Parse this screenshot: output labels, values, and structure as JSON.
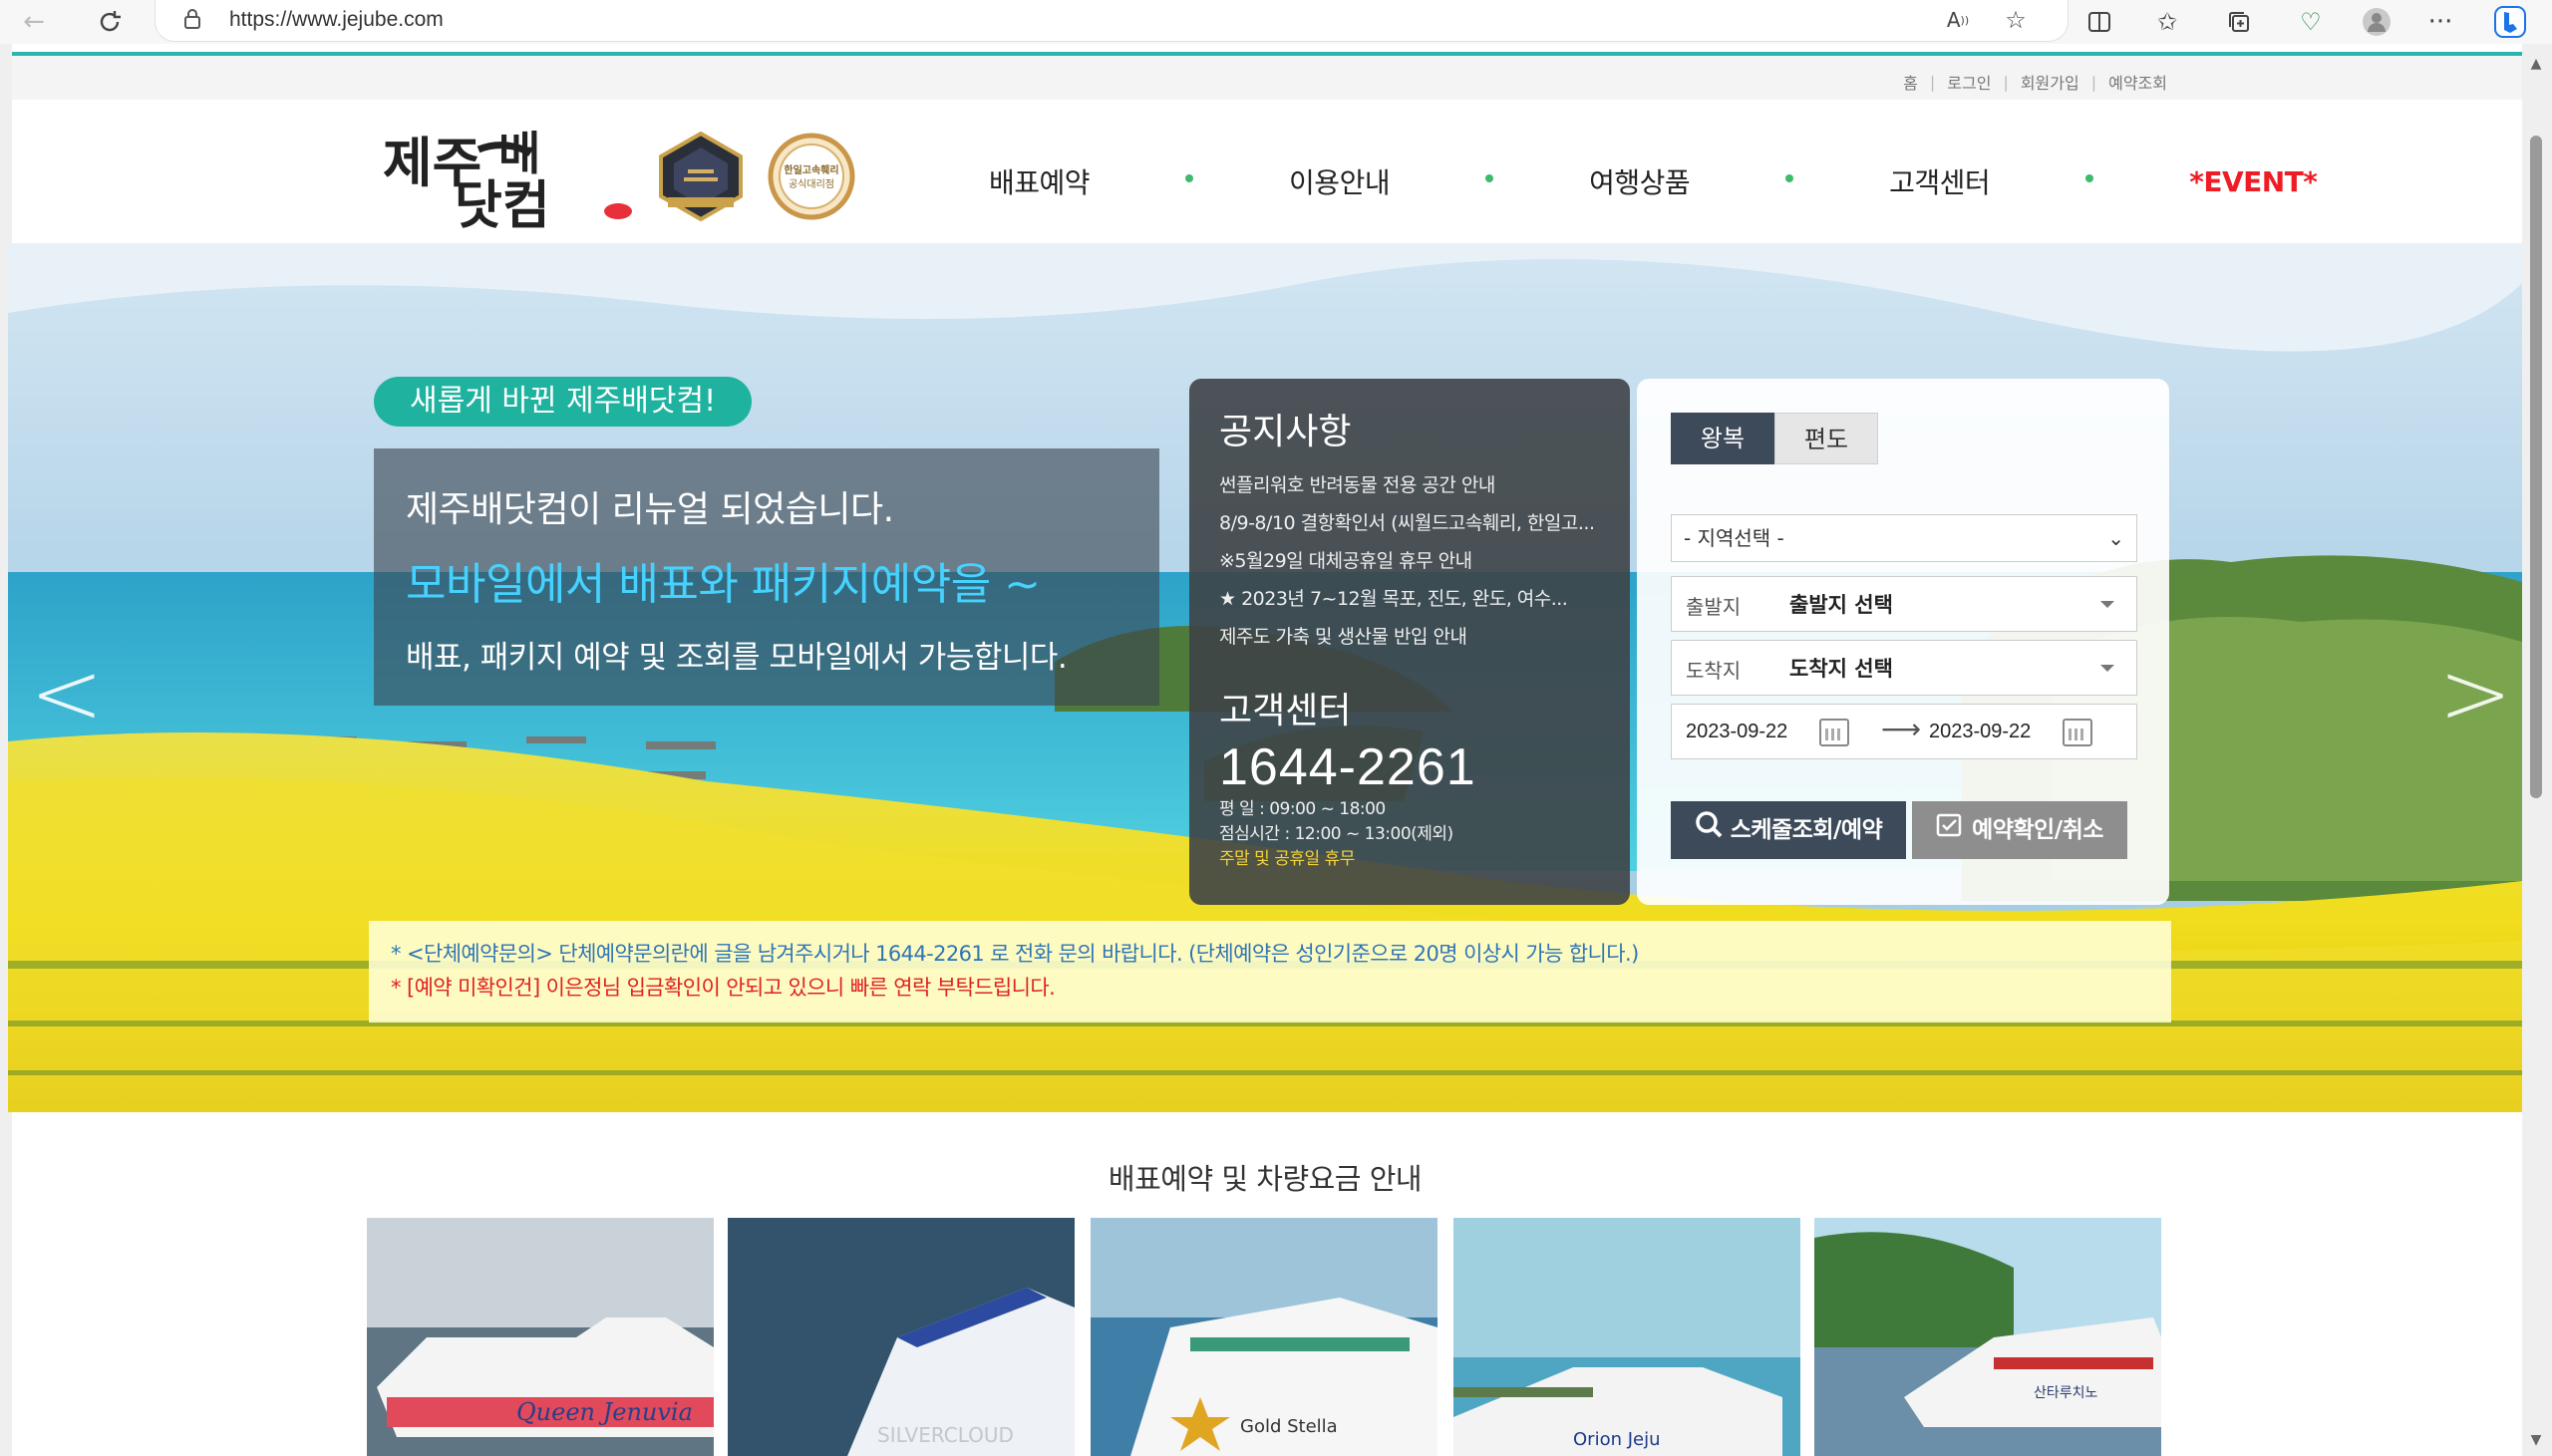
{
  "browser": {
    "url": "https://www.jejube.com",
    "back_icon": "back-arrow-icon",
    "reload_icon": "reload-icon"
  },
  "util_links": [
    {
      "label": "홈"
    },
    {
      "label": "로그인"
    },
    {
      "label": "회원가입"
    },
    {
      "label": "예약조회"
    }
  ],
  "header": {
    "logo_text": "제주배닷컴",
    "badge_right_text": "한일고속훼리 공식대리점",
    "nav": [
      "배표예약",
      "이용안내",
      "여행상품",
      "고객센터",
      "*EVENT*"
    ]
  },
  "hero": {
    "pill": "새롭게 바뀐 제주배닷컴!",
    "line1": "제주배닷컴이 리뉴얼 되었습니다.",
    "line2": "모바일에서 배표와 패키지예약을 ~",
    "line3": "배표, 패키지 예약 및 조회를 모바일에서 가능합니다."
  },
  "notice": {
    "title": "공지사항",
    "items": [
      "썬플리워호 반려동물 전용 공간 안내",
      "8/9-8/10 결항확인서 (씨월드고속훼리, 한일고...",
      "※5월29일 대체공휴일 휴무 안내",
      "★ 2023년 7~12월 목포, 진도, 완도, 여수...",
      "제주도 가축 및 생산물 반입 안내"
    ],
    "cs_title": "고객센터",
    "cs_phone": "1644-2261",
    "cs_weekday": "평 일 : 09:00 ~ 18:00",
    "cs_lunch": "점심시간 : 12:00 ~ 13:00(제외)",
    "cs_holiday": "주말 및 공휴일 휴무"
  },
  "booking": {
    "tab_round": "왕복",
    "tab_oneway": "편도",
    "region_select": "- 지역선택 -",
    "depart_label": "출발지",
    "depart_value": "출발지 선택",
    "arrive_label": "도착지",
    "arrive_value": "도착지 선택",
    "date_from": "2023-09-22",
    "date_to": "2023-09-22",
    "search_button": "스케줄조회/예약",
    "confirm_button": "예약확인/취소"
  },
  "alerts": {
    "line1": "* <단체예약문의> 단체예약문의란에 글을 남겨주시거나 1644-2261 로 전화 문의 바랍니다. (단체예약은 성인기준으로 20명 이상시 가능 합니다.)",
    "line2": "* [예약 미확인건] 이은정님 입금확인이 안되고 있으니 빠른 연락 부탁드립니다."
  },
  "section": {
    "title": "배표예약 및 차량요금 안내",
    "cards": [
      {
        "ship_text": "Queen Jenuvia"
      },
      {
        "ship_text": "SILVERCLOUD"
      },
      {
        "ship_text": "Gold Stella"
      },
      {
        "ship_text": "Orion Jeju"
      },
      {
        "ship_text": "산타루치노"
      }
    ]
  },
  "colors": {
    "teal_accent": "#2bb5b0",
    "pill_green": "#1fb39f",
    "hero_cyan": "#46d2ff",
    "event_red": "#ee1c25",
    "dark_button": "#3d4a5a",
    "notice_yellow": "#f3d43b"
  }
}
